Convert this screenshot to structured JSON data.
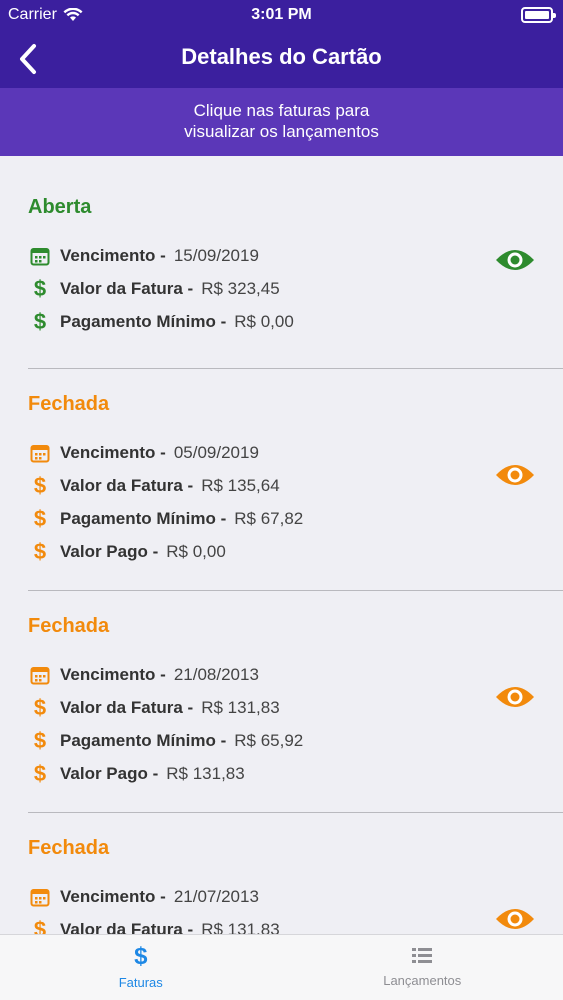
{
  "statusbar": {
    "carrier": "Carrier",
    "time": "3:01 PM"
  },
  "navbar": {
    "title": "Detalhes do Cartão",
    "back_icon": "chevron-left-icon"
  },
  "hint": {
    "line1": "Clique nas faturas para",
    "line2": "visualizar os lançamentos"
  },
  "colors": {
    "open": "#2e8b2e",
    "closed": "#f28a0c",
    "header": "#3b1f9e",
    "hint": "#5b37b8",
    "tab_active": "#1e88e5"
  },
  "invoices": [
    {
      "status": "Aberta",
      "rows": [
        {
          "label": "Vencimento -",
          "value": "15/09/2019"
        },
        {
          "label": "Valor da Fatura -",
          "value": "R$ 323,45"
        },
        {
          "label": "Pagamento Mínimo -",
          "value": "R$ 0,00"
        }
      ]
    },
    {
      "status": "Fechada",
      "rows": [
        {
          "label": "Vencimento -",
          "value": "05/09/2019"
        },
        {
          "label": "Valor da Fatura -",
          "value": "R$ 135,64"
        },
        {
          "label": "Pagamento Mínimo -",
          "value": "R$ 67,82"
        },
        {
          "label": "Valor Pago -",
          "value": "R$ 0,00"
        }
      ]
    },
    {
      "status": "Fechada",
      "rows": [
        {
          "label": "Vencimento -",
          "value": "21/08/2013"
        },
        {
          "label": "Valor da Fatura -",
          "value": "R$ 131,83"
        },
        {
          "label": "Pagamento Mínimo -",
          "value": "R$ 65,92"
        },
        {
          "label": "Valor Pago -",
          "value": "R$ 131,83"
        }
      ]
    },
    {
      "status": "Fechada",
      "rows": [
        {
          "label": "Vencimento -",
          "value": "21/07/2013"
        },
        {
          "label": "Valor da Fatura -",
          "value": "R$ 131,83"
        }
      ]
    }
  ],
  "tabbar": {
    "tabs": [
      {
        "label": "Faturas",
        "icon": "dollar-icon"
      },
      {
        "label": "Lançamentos",
        "icon": "list-icon"
      }
    ]
  }
}
